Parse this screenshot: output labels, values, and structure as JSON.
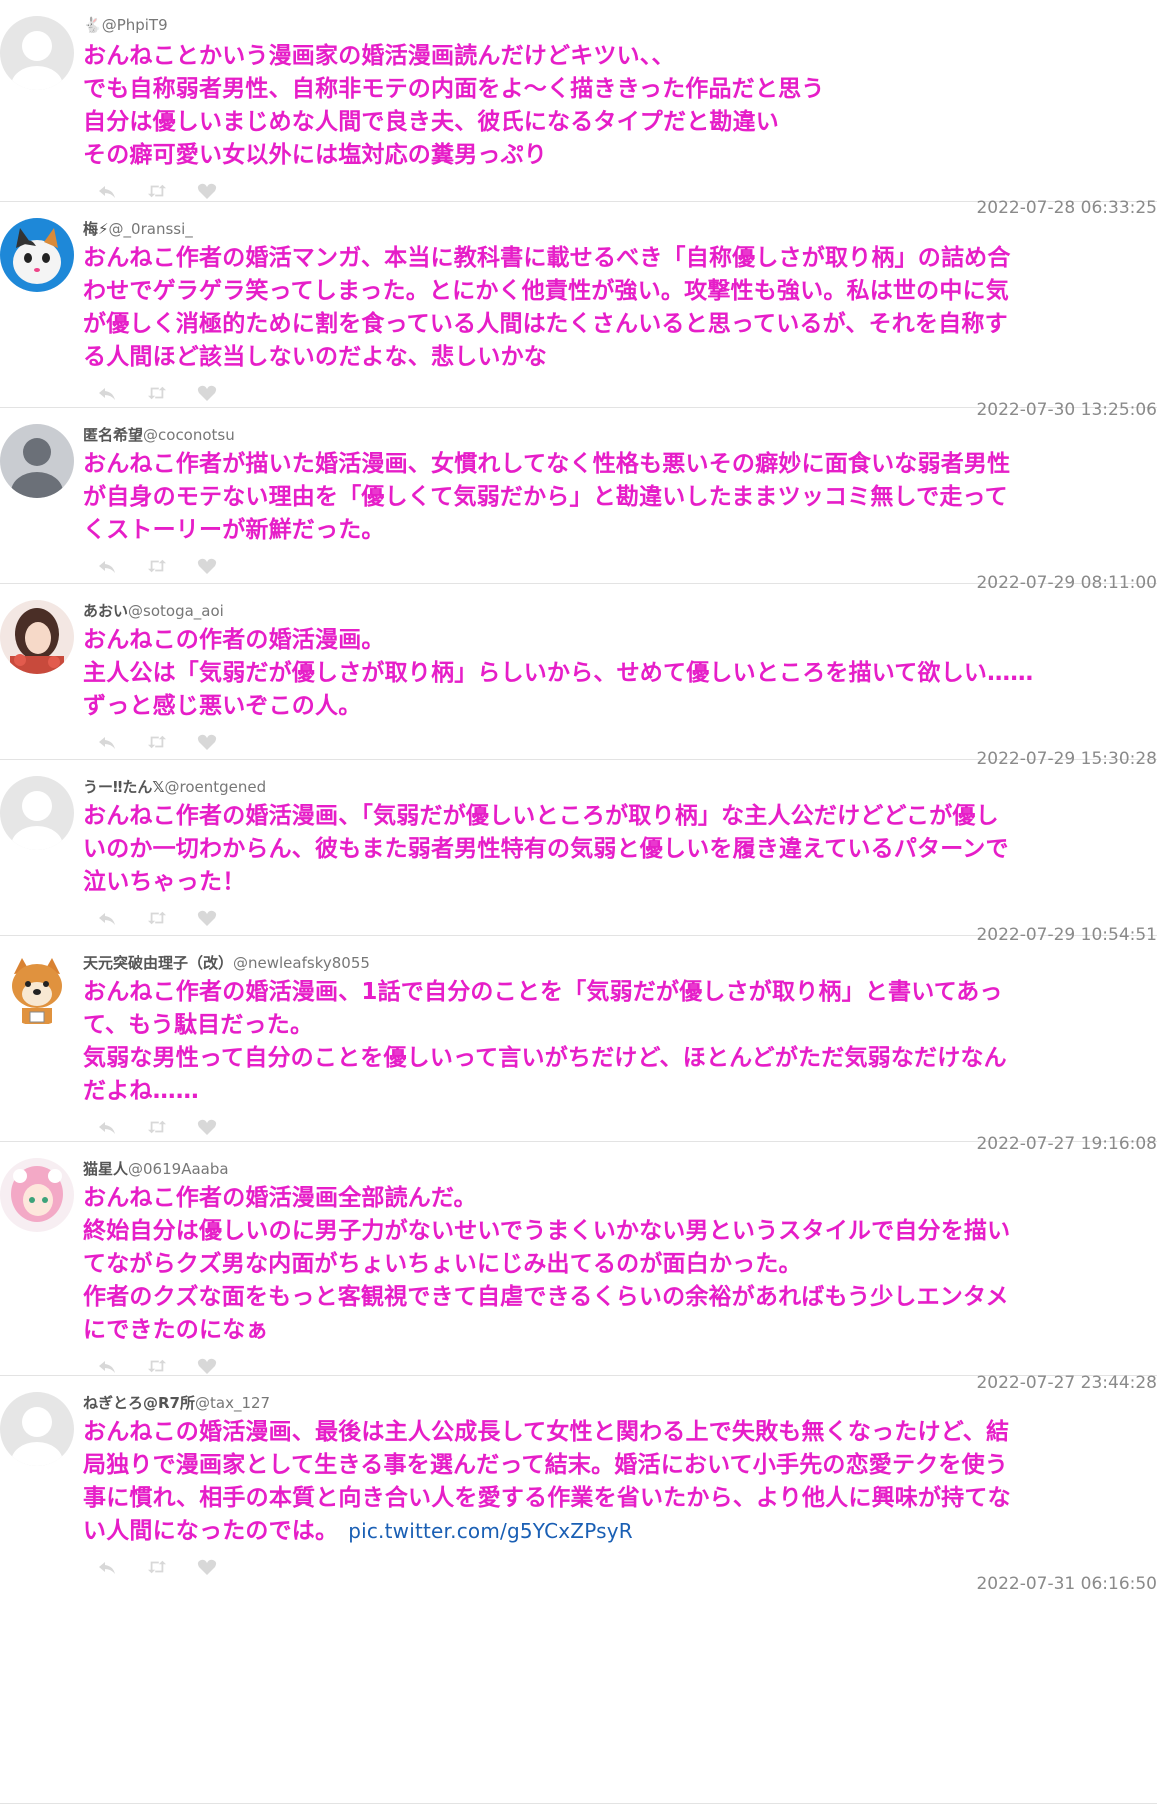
{
  "tweets": [
    {
      "display_name": "🐇",
      "handle": "@PhpiT9",
      "lines": [
        "おんねことかいう漫画家の婚活漫画読んだけどキツい、、",
        "でも自称弱者男性、自称非モテの内面をよ〜く描ききった作品だと思う",
        "自分は優しいまじめな人間で良き夫、彼氏になるタイプだと勘違い",
        "その癖可愛い女以外には塩対応の糞男っぷり"
      ],
      "link": "",
      "date": "2022-07-28 06:33:25",
      "avatar": "default"
    },
    {
      "display_name": "梅⚡",
      "handle": "@_0ranssi_",
      "lines": [
        "おんねこ作者の婚活マンガ、本当に教科書に載せるべき「自称優しさが取り柄」の詰め合",
        "わせでゲラゲラ笑ってしまった。とにかく他責性が強い。攻撃性も強い。私は世の中に気",
        "が優しく消極的ために割を食っている人間はたくさんいると思っているが、それを自称す",
        "る人間ほど該当しないのだよな、悲しいかな"
      ],
      "link": "",
      "date": "2022-07-30 13:25:06",
      "avatar": "cat"
    },
    {
      "display_name": "匿名希望",
      "handle": "@coconotsu",
      "lines": [
        "おんねこ作者が描いた婚活漫画、女慣れしてなく性格も悪いその癖妙に面食いな弱者男性",
        "が自身のモテない理由を「優しくて気弱だから」と勘違いしたままツッコミ無しで走って",
        "くストーリーが新鮮だった。"
      ],
      "link": "",
      "date": "2022-07-29 08:11:00",
      "avatar": "gray"
    },
    {
      "display_name": "あおい",
      "handle": "@sotoga_aoi",
      "lines": [
        "おんねこの作者の婚活漫画。",
        "主人公は「気弱だが優しさが取り柄」らしいから、せめて優しいところを描いて欲しい……",
        "ずっと感じ悪いぞこの人。"
      ],
      "link": "",
      "date": "2022-07-29 15:30:28",
      "avatar": "girl"
    },
    {
      "display_name": "うー‼たん𝕏",
      "handle": "@roentgened",
      "lines": [
        "おんねこ作者の婚活漫画、「気弱だが優しいところが取り柄」な主人公だけどどこが優し",
        "いのか一切わからん、彼もまた弱者男性特有の気弱と優しいを履き違えているパターンで",
        "泣いちゃった！"
      ],
      "link": "",
      "date": "2022-07-29 10:54:51",
      "avatar": "default"
    },
    {
      "display_name": "天元突破由理子（改）",
      "handle": "@newleafsky8055",
      "lines": [
        "おんねこ作者の婚活漫画、1話で自分のことを「気弱だが優しさが取り柄」と書いてあっ",
        "て、もう駄目だった。",
        "気弱な男性って自分のことを優しいって言いがちだけど、ほとんどがただ気弱なだけなん",
        "だよね……"
      ],
      "link": "",
      "date": "2022-07-27 19:16:08",
      "avatar": "dog"
    },
    {
      "display_name": "猫星人",
      "handle": "@0619Aaaba",
      "lines": [
        "おんねこ作者の婚活漫画全部読んだ。",
        "終始自分は優しいのに男子力がないせいでうまくいかない男というスタイルで自分を描い",
        "てながらクズ男な内面がちょいちょいにじみ出てるのが面白かった。",
        "作者のクズな面をもっと客観視できて自虐できるくらいの余裕があればもう少しエンタメ",
        "にできたのになぁ"
      ],
      "link": "",
      "date": "2022-07-27 23:44:28",
      "avatar": "pink"
    },
    {
      "display_name": "ねぎとろ@R7所",
      "handle": "@tax_127",
      "lines": [
        "おんねこの婚活漫画、最後は主人公成長して女性と関わる上で失敗も無くなったけど、結",
        "局独りで漫画家として生きる事を選んだって結末。婚活において小手先の恋愛テクを使う",
        "事に慣れ、相手の本質と向き合い人を愛する作業を省いたから、より他人に興味が持てな",
        "い人間になったのでは。"
      ],
      "link": "pic.twitter.com/g5YCxZPsyR",
      "date": "2022-07-31 06:16:50",
      "avatar": "default"
    }
  ],
  "icons": {
    "reply": "reply-icon",
    "retweet": "retweet-icon",
    "like": "heart-icon"
  }
}
